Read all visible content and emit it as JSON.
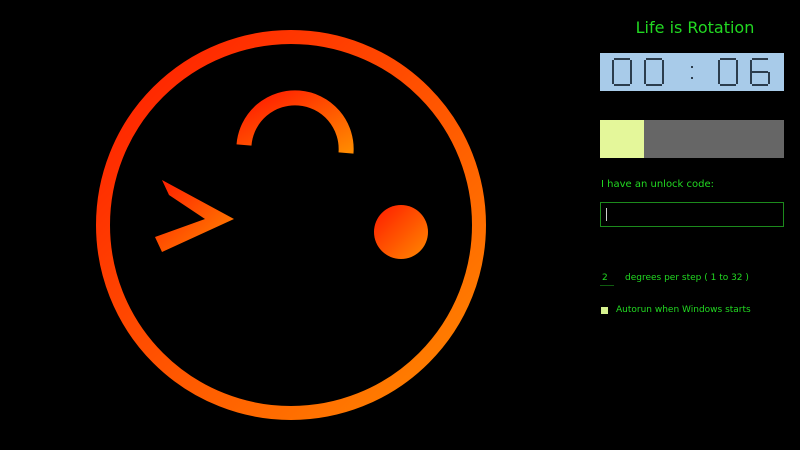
{
  "app": {
    "title": "Life is Rotation"
  },
  "timer": {
    "display": "00:06",
    "digits": [
      "0",
      "0",
      "0",
      "6"
    ],
    "background": "#a8cbe9",
    "digit_color": "#2c3d4d"
  },
  "progress": {
    "fraction": 0.24,
    "fill_color": "#e4f79a",
    "track_color": "#666666"
  },
  "unlock": {
    "label": "I have an unlock code:",
    "value": ""
  },
  "degrees": {
    "value": "2",
    "label": "degrees per step ( 1 to 32 )"
  },
  "autorun": {
    "label": "Autorun when Windows starts",
    "checked": true
  },
  "face": {
    "gradient_start": "#ff1a00",
    "gradient_end": "#ff8a00",
    "expression": "wink-smiley"
  },
  "colors": {
    "accent_text": "#22d822",
    "background": "#000000"
  }
}
